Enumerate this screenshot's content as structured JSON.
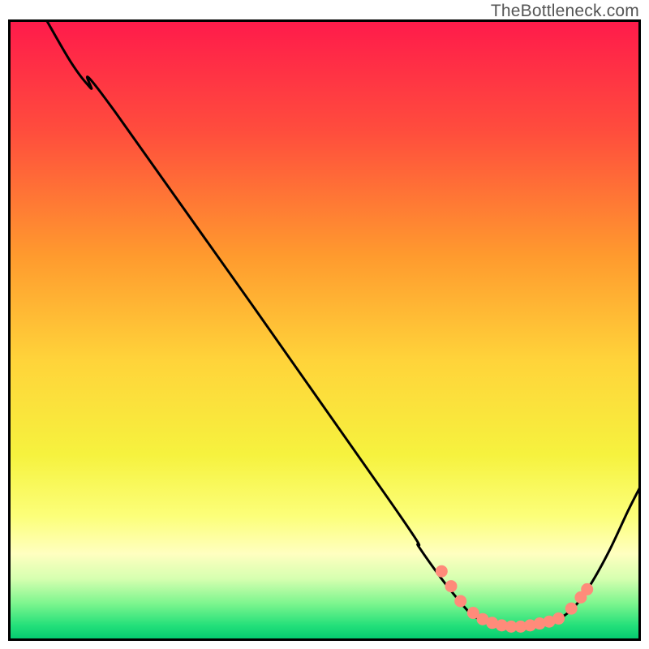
{
  "watermark": "TheBottleneck.com",
  "chart_data": {
    "type": "line",
    "title": "",
    "xlabel": "",
    "ylabel": "",
    "xlim": [
      0,
      100
    ],
    "ylim": [
      0,
      100
    ],
    "grid": false,
    "legend": false,
    "background_gradient": {
      "stops": [
        {
          "offset": 0.0,
          "color": "#ff1a4b"
        },
        {
          "offset": 0.18,
          "color": "#ff4d3d"
        },
        {
          "offset": 0.38,
          "color": "#ff9a2e"
        },
        {
          "offset": 0.55,
          "color": "#ffd43a"
        },
        {
          "offset": 0.7,
          "color": "#f6f23e"
        },
        {
          "offset": 0.8,
          "color": "#fcff7a"
        },
        {
          "offset": 0.86,
          "color": "#ffffc0"
        },
        {
          "offset": 0.9,
          "color": "#d6ffb0"
        },
        {
          "offset": 0.94,
          "color": "#7cf58e"
        },
        {
          "offset": 0.975,
          "color": "#24e07a"
        },
        {
          "offset": 1.0,
          "color": "#00c86e"
        }
      ]
    },
    "curve": {
      "anchors_xy": [
        [
          6,
          100
        ],
        [
          10,
          93
        ],
        [
          13,
          89
        ],
        [
          17,
          85
        ],
        [
          60,
          23
        ],
        [
          65,
          15
        ],
        [
          68.5,
          10
        ],
        [
          71,
          6.8
        ],
        [
          73,
          4.5
        ],
        [
          75,
          3.2
        ],
        [
          78,
          2.5
        ],
        [
          81,
          2.3
        ],
        [
          84,
          2.5
        ],
        [
          87,
          3.5
        ],
        [
          89.5,
          5.5
        ],
        [
          92,
          9
        ],
        [
          95,
          14.5
        ],
        [
          98,
          21
        ],
        [
          100,
          25
        ]
      ]
    },
    "highlight_dots_xy": [
      [
        68.5,
        11.2
      ],
      [
        70.0,
        8.8
      ],
      [
        71.5,
        6.4
      ],
      [
        73.5,
        4.5
      ],
      [
        75.0,
        3.5
      ],
      [
        76.5,
        2.9
      ],
      [
        78.0,
        2.5
      ],
      [
        79.5,
        2.3
      ],
      [
        81.0,
        2.3
      ],
      [
        82.5,
        2.5
      ],
      [
        84.0,
        2.8
      ],
      [
        85.5,
        3.1
      ],
      [
        87.0,
        3.6
      ],
      [
        89.0,
        5.2
      ],
      [
        90.5,
        7.0
      ],
      [
        91.5,
        8.3
      ]
    ],
    "dot_style": {
      "r": 7,
      "fill": "#ff8b7a",
      "stroke": "#ff8b7a"
    },
    "curve_style": {
      "stroke": "#000000",
      "width": 3
    },
    "border": {
      "color": "#000000",
      "width": 3
    }
  }
}
